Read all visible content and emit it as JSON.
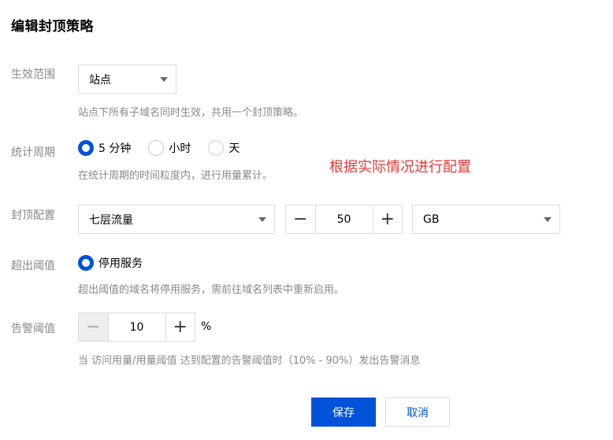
{
  "dialog": {
    "title": "编辑封顶策略"
  },
  "scope": {
    "label": "生效范围",
    "value": "站点",
    "hint": "站点下所有子域名同时生效，共用一个封顶策略。"
  },
  "period": {
    "label": "统计周期",
    "options": [
      "5 分钟",
      "小时",
      "天"
    ],
    "selected": "5 分钟",
    "hint": "在统计周期的时间粒度内，进行用量累计。"
  },
  "annotation": "根据实际情况进行配置",
  "cap": {
    "label": "封顶配置",
    "metric": "七层流量",
    "value": "50",
    "unit": "GB",
    "minus": "−",
    "plus": "+"
  },
  "exceed": {
    "label": "超出阈值",
    "option": "停用服务",
    "hint": "超出阈值的域名将停用服务，需前往域名列表中重新启用。"
  },
  "alert": {
    "label": "告警阈值",
    "value": "10",
    "unit": "%",
    "minus": "−",
    "plus": "+",
    "hint": "当 访问用量/用量阈值 达到配置的告警阈值时（10% - 90%）发出告警消息"
  },
  "actions": {
    "save": "保存",
    "cancel": "取消"
  },
  "colors": {
    "primary": "#0052d9",
    "annotation": "#e53935"
  }
}
